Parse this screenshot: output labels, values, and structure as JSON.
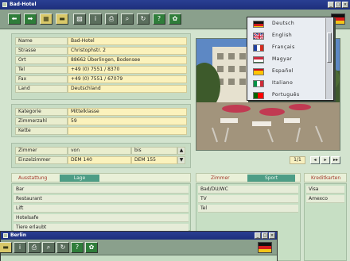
{
  "window": {
    "title": "Bad-Hotel"
  },
  "toolbar": {
    "buttons": [
      {
        "icon": "arrow-left-icon",
        "glyph": "⬅"
      },
      {
        "icon": "arrow-right-icon",
        "glyph": "➡"
      },
      {
        "icon": "table-icon",
        "glyph": "▦"
      },
      {
        "icon": "folder-icon",
        "glyph": "▬"
      },
      {
        "icon": "image-icon",
        "glyph": "▨"
      },
      {
        "icon": "info-icon",
        "glyph": "i"
      },
      {
        "icon": "print-icon",
        "glyph": "⎙"
      },
      {
        "icon": "search-icon",
        "glyph": "⌕"
      },
      {
        "icon": "refresh-icon",
        "glyph": "↻"
      },
      {
        "icon": "help-icon",
        "glyph": "?"
      },
      {
        "icon": "settings-icon",
        "glyph": "✿"
      }
    ]
  },
  "address": {
    "rows": [
      {
        "label": "Name",
        "value": "Bad-Hotel"
      },
      {
        "label": "Strasse",
        "value": "Christophstr. 2"
      },
      {
        "label": "Ort",
        "value": "88662 Überlingen, Bodensee"
      },
      {
        "label": "Tel",
        "value": "+49 (0) 7551 / 8370"
      },
      {
        "label": "Fax",
        "value": "+49 (0) 7551 / 67079"
      },
      {
        "label": "Land",
        "value": "Deutschland"
      }
    ]
  },
  "category": {
    "rows": [
      {
        "label": "Kategorie",
        "value": "Mittelklasse"
      },
      {
        "label": "Zimmerzahl",
        "value": "59"
      },
      {
        "label": "Kette",
        "value": ""
      }
    ]
  },
  "rooms": {
    "header": {
      "label": "Zimmer",
      "from": "von",
      "to": "bis"
    },
    "row": {
      "label": "Einzelzimmer",
      "from": "DEM 140",
      "to": "DEM 155"
    }
  },
  "pager": {
    "count": "1/1"
  },
  "tabs": {
    "left": {
      "label1": "Ausstattung",
      "label2": "Lage",
      "items": [
        "Bar",
        "Restaurant",
        "Lift",
        "Hotelsafe",
        "Tiere erlaubt"
      ]
    },
    "mid": {
      "label1": "Zimmer",
      "label2": "Sport",
      "items": [
        "Bad/DU/WC",
        "TV",
        "Tel"
      ]
    },
    "right": {
      "label1": "Kreditkarten",
      "items": [
        "Visa",
        "Amexco"
      ]
    }
  },
  "languages": [
    {
      "name": "Deutsch",
      "flag": "de"
    },
    {
      "name": "English",
      "flag": "gb"
    },
    {
      "name": "Français",
      "flag": "fr"
    },
    {
      "name": "Magyar",
      "flag": "hu"
    },
    {
      "name": "Español",
      "flag": "es"
    },
    {
      "name": "Italiano",
      "flag": "it"
    },
    {
      "name": "Português",
      "flag": "pt"
    }
  ],
  "window2": {
    "title": "Berlin"
  }
}
